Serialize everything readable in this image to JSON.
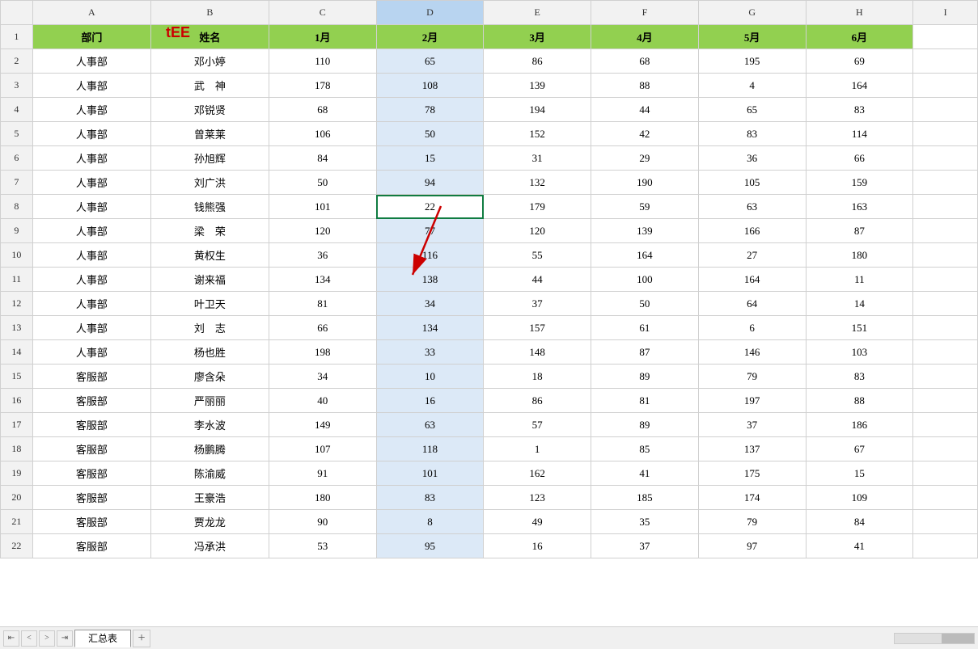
{
  "sheet": {
    "columns": [
      "",
      "A",
      "B",
      "C",
      "D",
      "E",
      "F",
      "G",
      "H",
      "I"
    ],
    "col_labels": [
      "部门",
      "姓名",
      "1月",
      "2月",
      "3月",
      "4月",
      "5月",
      "6月"
    ],
    "active_cell": "D8",
    "tab_label": "汇总表",
    "add_tab_label": "+"
  },
  "rows": [
    {
      "row": 1,
      "dept": "部门",
      "name": "姓名",
      "m1": "1月",
      "m2": "2月",
      "m3": "3月",
      "m4": "4月",
      "m5": "5月",
      "m6": "6月"
    },
    {
      "row": 2,
      "dept": "人事部",
      "name": "邓小婷",
      "m1": "110",
      "m2": "65",
      "m3": "86",
      "m4": "68",
      "m5": "195",
      "m6": "69"
    },
    {
      "row": 3,
      "dept": "人事部",
      "name": "武　神",
      "m1": "178",
      "m2": "108",
      "m3": "139",
      "m4": "88",
      "m5": "4",
      "m6": "164"
    },
    {
      "row": 4,
      "dept": "人事部",
      "name": "邓锐贤",
      "m1": "68",
      "m2": "78",
      "m3": "194",
      "m4": "44",
      "m5": "65",
      "m6": "83"
    },
    {
      "row": 5,
      "dept": "人事部",
      "name": "曾莱莱",
      "m1": "106",
      "m2": "50",
      "m3": "152",
      "m4": "42",
      "m5": "83",
      "m6": "114"
    },
    {
      "row": 6,
      "dept": "人事部",
      "name": "孙旭辉",
      "m1": "84",
      "m2": "15",
      "m3": "31",
      "m4": "29",
      "m5": "36",
      "m6": "66"
    },
    {
      "row": 7,
      "dept": "人事部",
      "name": "刘广洪",
      "m1": "50",
      "m2": "94",
      "m3": "132",
      "m4": "190",
      "m5": "105",
      "m6": "159"
    },
    {
      "row": 8,
      "dept": "人事部",
      "name": "钱熊强",
      "m1": "101",
      "m2": "22",
      "m3": "179",
      "m4": "59",
      "m5": "63",
      "m6": "163"
    },
    {
      "row": 9,
      "dept": "人事部",
      "name": "梁　荣",
      "m1": "120",
      "m2": "77",
      "m3": "120",
      "m4": "139",
      "m5": "166",
      "m6": "87"
    },
    {
      "row": 10,
      "dept": "人事部",
      "name": "黄权生",
      "m1": "36",
      "m2": "116",
      "m3": "55",
      "m4": "164",
      "m5": "27",
      "m6": "180"
    },
    {
      "row": 11,
      "dept": "人事部",
      "name": "谢来福",
      "m1": "134",
      "m2": "138",
      "m3": "44",
      "m4": "100",
      "m5": "164",
      "m6": "11"
    },
    {
      "row": 12,
      "dept": "人事部",
      "name": "叶卫天",
      "m1": "81",
      "m2": "34",
      "m3": "37",
      "m4": "50",
      "m5": "64",
      "m6": "14"
    },
    {
      "row": 13,
      "dept": "人事部",
      "name": "刘　志",
      "m1": "66",
      "m2": "134",
      "m3": "157",
      "m4": "61",
      "m5": "6",
      "m6": "151"
    },
    {
      "row": 14,
      "dept": "人事部",
      "name": "杨也胜",
      "m1": "198",
      "m2": "33",
      "m3": "148",
      "m4": "87",
      "m5": "146",
      "m6": "103"
    },
    {
      "row": 15,
      "dept": "客服部",
      "name": "廖含朵",
      "m1": "34",
      "m2": "10",
      "m3": "18",
      "m4": "89",
      "m5": "79",
      "m6": "83"
    },
    {
      "row": 16,
      "dept": "客服部",
      "name": "严丽丽",
      "m1": "40",
      "m2": "16",
      "m3": "86",
      "m4": "81",
      "m5": "197",
      "m6": "88"
    },
    {
      "row": 17,
      "dept": "客服部",
      "name": "李水波",
      "m1": "149",
      "m2": "63",
      "m3": "57",
      "m4": "89",
      "m5": "37",
      "m6": "186"
    },
    {
      "row": 18,
      "dept": "客服部",
      "name": "杨鹏腾",
      "m1": "107",
      "m2": "118",
      "m3": "1",
      "m4": "85",
      "m5": "137",
      "m6": "67"
    },
    {
      "row": 19,
      "dept": "客服部",
      "name": "陈渝威",
      "m1": "91",
      "m2": "101",
      "m3": "162",
      "m4": "41",
      "m5": "175",
      "m6": "15"
    },
    {
      "row": 20,
      "dept": "客服部",
      "name": "王豪浩",
      "m1": "180",
      "m2": "83",
      "m3": "123",
      "m4": "185",
      "m5": "174",
      "m6": "109"
    },
    {
      "row": 21,
      "dept": "客服部",
      "name": "贾龙龙",
      "m1": "90",
      "m2": "8",
      "m3": "49",
      "m4": "35",
      "m5": "79",
      "m6": "84"
    },
    {
      "row": 22,
      "dept": "客服部",
      "name": "冯承洪",
      "m1": "53",
      "m2": "95",
      "m3": "16",
      "m4": "37",
      "m5": "97",
      "m6": "41"
    }
  ],
  "annotation": {
    "tee_label": "tEE",
    "arrow_color": "#cc0000"
  }
}
